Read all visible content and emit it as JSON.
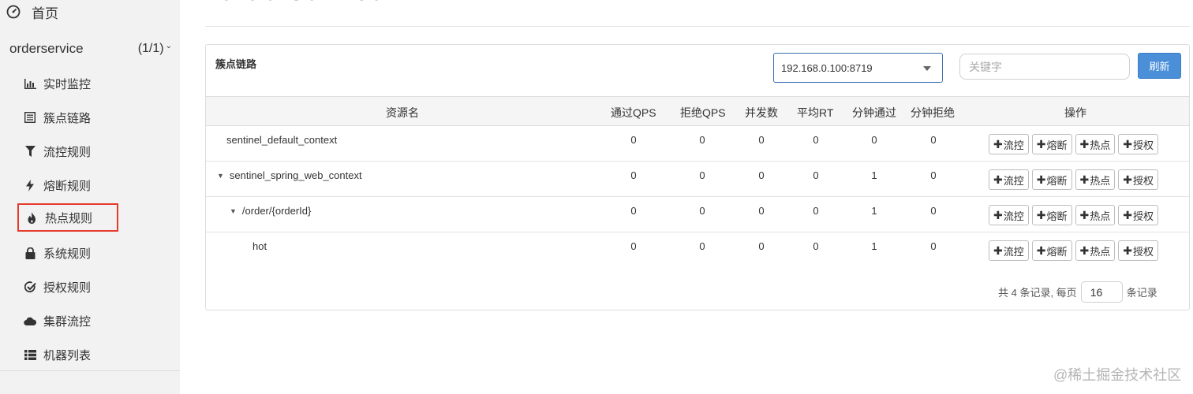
{
  "sidebar": {
    "home_label": "首页",
    "app_name": "orderservice",
    "app_count": "(1/1)",
    "items": [
      {
        "label": "实时监控",
        "icon": "bar-chart-icon"
      },
      {
        "label": "簇点链路",
        "icon": "list-icon"
      },
      {
        "label": "流控规则",
        "icon": "filter-icon"
      },
      {
        "label": "熔断规则",
        "icon": "bolt-icon"
      },
      {
        "label": "热点规则",
        "icon": "fire-icon"
      },
      {
        "label": "系统规则",
        "icon": "lock-icon"
      },
      {
        "label": "授权规则",
        "icon": "check-circle-icon"
      },
      {
        "label": "集群流控",
        "icon": "cloud-icon"
      },
      {
        "label": "机器列表",
        "icon": "th-list-icon"
      }
    ],
    "highlight_color": "#e53b2c"
  },
  "header": {
    "title": "orderservice"
  },
  "panel": {
    "title": "簇点链路",
    "machine_selected": "192.168.0.100:8719",
    "keyword_placeholder": "关键字",
    "keyword_value": "",
    "refresh_label": "刷新"
  },
  "table": {
    "columns": [
      "资源名",
      "通过QPS",
      "拒绝QPS",
      "并发数",
      "平均RT",
      "分钟通过",
      "分钟拒绝",
      "操作"
    ],
    "rows": [
      {
        "name": "sentinel_default_context",
        "expanded": false,
        "pass_qps": "0",
        "block_qps": "0",
        "threads": "0",
        "avg_rt": "0",
        "min_pass": "0",
        "min_block": "0"
      },
      {
        "name": "sentinel_spring_web_context",
        "expanded": true,
        "pass_qps": "0",
        "block_qps": "0",
        "threads": "0",
        "avg_rt": "0",
        "min_pass": "1",
        "min_block": "0"
      },
      {
        "name": "/order/{orderId}",
        "expanded": true,
        "pass_qps": "0",
        "block_qps": "0",
        "threads": "0",
        "avg_rt": "0",
        "min_pass": "1",
        "min_block": "0"
      },
      {
        "name": "hot",
        "expanded": false,
        "pass_qps": "0",
        "block_qps": "0",
        "threads": "0",
        "avg_rt": "0",
        "min_pass": "1",
        "min_block": "0"
      }
    ],
    "actions": {
      "flow": "流控",
      "degrade": "熔断",
      "param": "热点",
      "authority": "授权"
    }
  },
  "pagination": {
    "prefix": "共 4 条记录, 每页",
    "page_size": "16",
    "suffix": "条记录"
  },
  "watermark": "@稀土掘金技术社区",
  "colors": {
    "primary": "#4a8fd8",
    "select_border": "#3a6fb0",
    "sidebar_bg": "#f2f2f2"
  }
}
